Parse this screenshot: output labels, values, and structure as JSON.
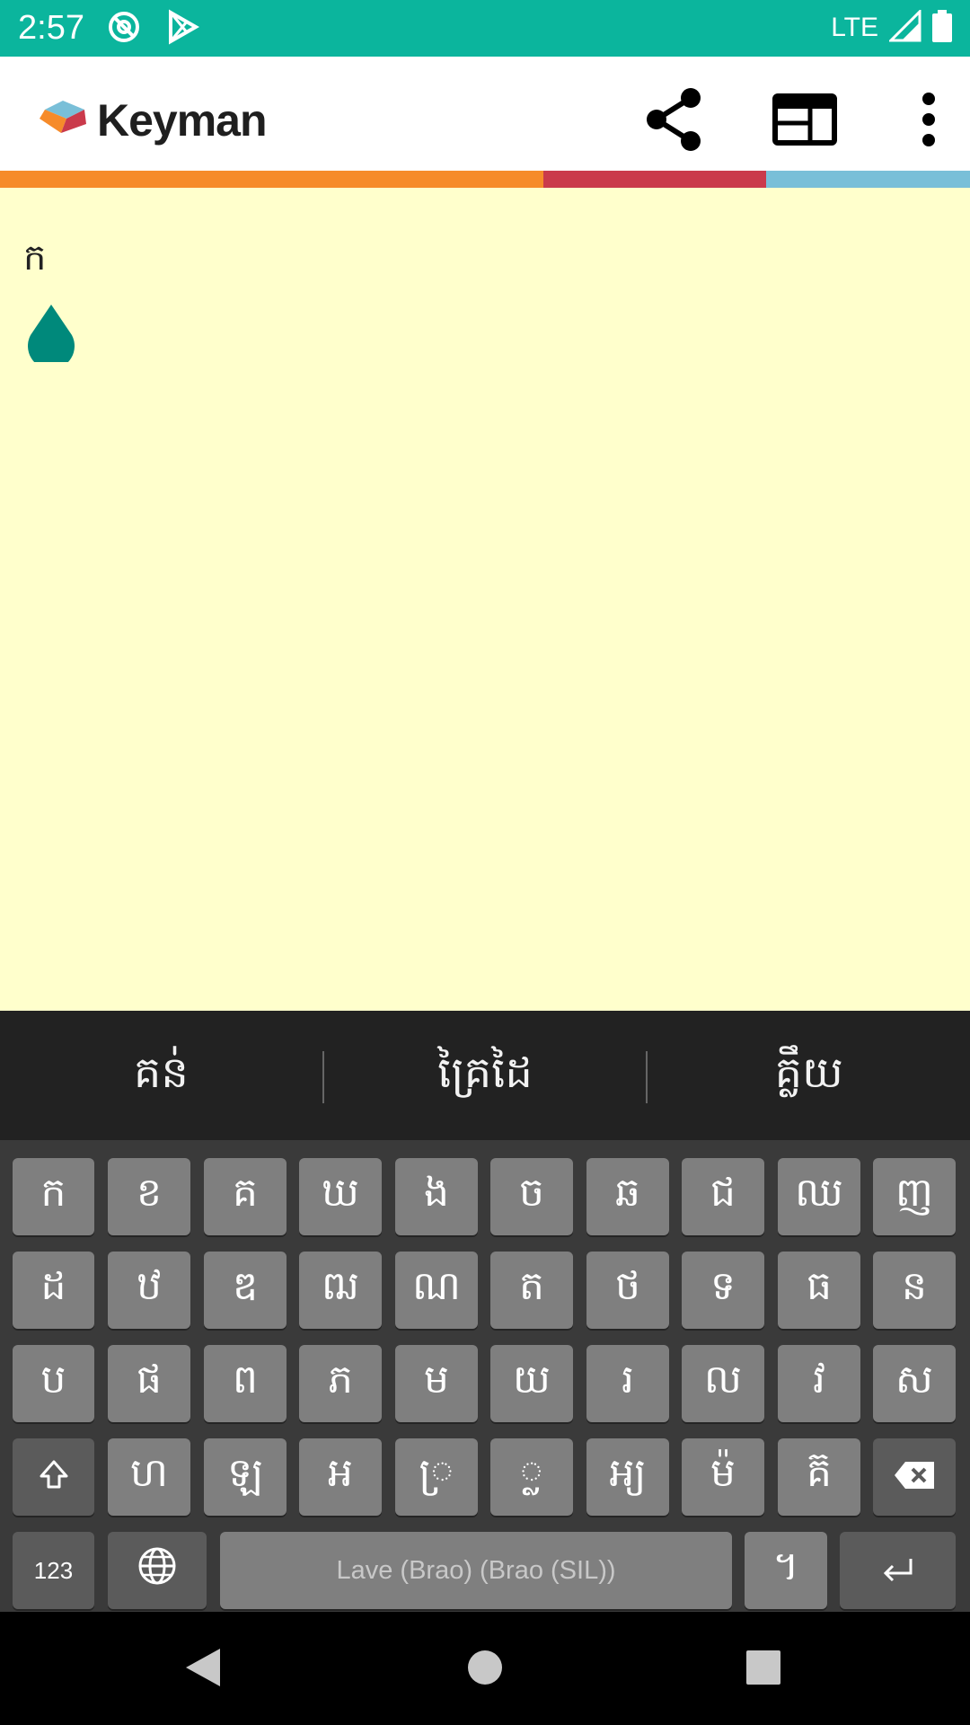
{
  "status_bar": {
    "time": "2:57",
    "network": "LTE",
    "icons": [
      "sync-icon",
      "play-store-icon",
      "signal-icon",
      "battery-icon"
    ]
  },
  "app_bar": {
    "logo_text": "Keyman",
    "actions": [
      "share-icon",
      "layout-icon",
      "more-vert-icon"
    ]
  },
  "colors": {
    "status_bar": "#0bb59d",
    "text_area_bg": "#ffffcc",
    "strip_orange": "#f68b2a",
    "strip_red": "#ca3a4b",
    "strip_blue": "#79bfd8",
    "cursor_handle": "#00897b",
    "key_bg": "#7f7f7f",
    "key_dark_bg": "#5b5b5b",
    "keyboard_bg": "#3a3a3a"
  },
  "editor": {
    "text": "ក"
  },
  "suggestions": [
    "គន់",
    "គ្រៃដៃ",
    "គ្លឹយ"
  ],
  "keyboard": {
    "rows": [
      [
        "ក",
        "ខ",
        "គ",
        "ឃ",
        "ង",
        "ច",
        "ឆ",
        "ជ",
        "ឈ",
        "ញ"
      ],
      [
        "ដ",
        "ឋ",
        "ឌ",
        "ឍ",
        "ណ",
        "ត",
        "ថ",
        "ទ",
        "ធ",
        "ន"
      ],
      [
        "ប",
        "ផ",
        "ព",
        "ភ",
        "ម",
        "យ",
        "រ",
        "ល",
        "វ",
        "ស"
      ],
      [
        "ហ",
        "ឡ",
        "អ",
        "◌្រ",
        "◌្ល",
        "អ្យ",
        "ម៉",
        "គ៊"
      ]
    ],
    "numbers_label": "123",
    "space_label": "Lave (Brao) (Brao (SIL))",
    "punct_label": "។"
  }
}
